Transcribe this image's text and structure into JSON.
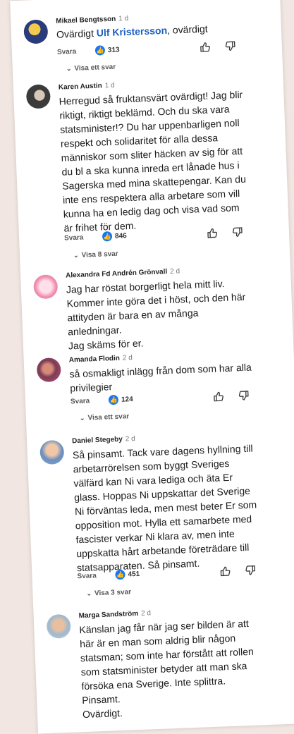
{
  "reply_label": "Svara",
  "comments": [
    {
      "author": "Mikael Bengtsson",
      "time": "1 d",
      "text_before": "Ovärdigt ",
      "mention": "Ulf Kristersson",
      "text_after": ", ovärdigt",
      "likes": "313",
      "replies_label": "Visa ett svar"
    },
    {
      "author": "Karen Austin",
      "time": "1 d",
      "text": "Herregud så fruktansvärt ovärdigt! Jag blir riktigt, riktigt beklämd. Och du ska vara statsminister!? Du har uppenbarligen noll respekt och solidaritet för alla dessa människor som sliter häcken av sig för att du bl a ska kunna inreda ert lånade hus i Sagerska med mina skattepengar. Kan du inte ens respektera alla arbetare som vill kunna ha en ledig dag och visa vad som är frihet för dem.",
      "likes": "846",
      "replies_label": "Visa 8 svar"
    },
    {
      "author": "Alexandra Fd Andrén Grönvall",
      "time": "2 d",
      "text": "Jag har röstat borgerligt hela mitt liv. Kommer inte göra det i höst, och den här attityden är bara en av många anledningar.\nJag skäms för er."
    },
    {
      "author": "Amanda Flodin",
      "time": "2 d",
      "text": "så osmakligt inlägg från dom som har alla privilegier",
      "likes": "124",
      "replies_label": "Visa ett svar"
    },
    {
      "author": "Daniel Stegeby",
      "time": "2 d",
      "text": "Så pinsamt. Tack vare dagens hyllning till arbetarrörelsen som byggt Sveriges välfärd kan Ni vara lediga och äta Er glass. Hoppas Ni uppskattar det Sverige Ni förväntas leda, men mest beter Er som opposition mot. Hylla ett samarbete med fascister verkar Ni klara av, men inte uppskatta hårt arbetande företrädare till statsapparaten. Så pinsamt.",
      "likes": "451",
      "replies_label": "Visa 3 svar"
    },
    {
      "author": "Marga Sandström",
      "time": "2 d",
      "text": "Känslan jag får när jag ser bilden är att här är en man som aldrig blir någon statsman; som inte har förstått att rollen som statsminister betyder att man ska försöka ena Sverige. Inte splittra.\nPinsamt.\nOvärdigt."
    }
  ]
}
